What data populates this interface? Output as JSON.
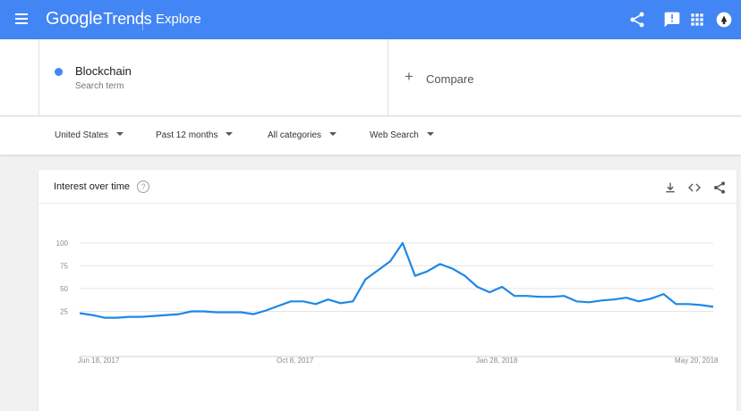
{
  "header": {
    "logo_google": "Google",
    "logo_trends": "Trends",
    "page_title": "Explore",
    "icons": [
      "menu-icon",
      "share-icon",
      "feedback-icon",
      "apps-icon",
      "account-icon"
    ],
    "color": "#4285f4"
  },
  "search_term": {
    "name": "Blockchain",
    "subtitle": "Search term",
    "color": "#4285f4"
  },
  "compare": {
    "plus": "+",
    "label": "Compare"
  },
  "filters": [
    {
      "label": "United States"
    },
    {
      "label": "Past 12 months"
    },
    {
      "label": "All categories"
    },
    {
      "label": "Web Search"
    }
  ],
  "card": {
    "title": "Interest over time",
    "help": "?",
    "icons": [
      "download-icon",
      "embed-icon",
      "share-icon"
    ]
  },
  "chart_data": {
    "type": "line",
    "title": "",
    "xlabel": "",
    "ylabel": "",
    "ylim": [
      0,
      100
    ],
    "y_ticks": [
      25,
      50,
      75,
      100
    ],
    "x_tick_labels": [
      "Jun 18, 2017",
      "Oct 8, 2017",
      "Jan 28, 2018",
      "May 20, 2018"
    ],
    "grid": true,
    "legend": "none",
    "series": [
      {
        "color": "#1e88e5",
        "values": [
          23,
          21,
          18,
          18,
          19,
          19,
          20,
          21,
          22,
          25,
          25,
          24,
          24,
          24,
          22,
          26,
          31,
          36,
          36,
          33,
          38,
          34,
          36,
          60,
          70,
          80,
          100,
          64,
          69,
          77,
          72,
          64,
          52,
          46,
          52,
          42,
          42,
          41,
          41,
          42,
          36,
          35,
          37,
          38,
          40,
          36,
          39,
          44,
          33,
          33,
          32,
          30
        ]
      }
    ]
  }
}
